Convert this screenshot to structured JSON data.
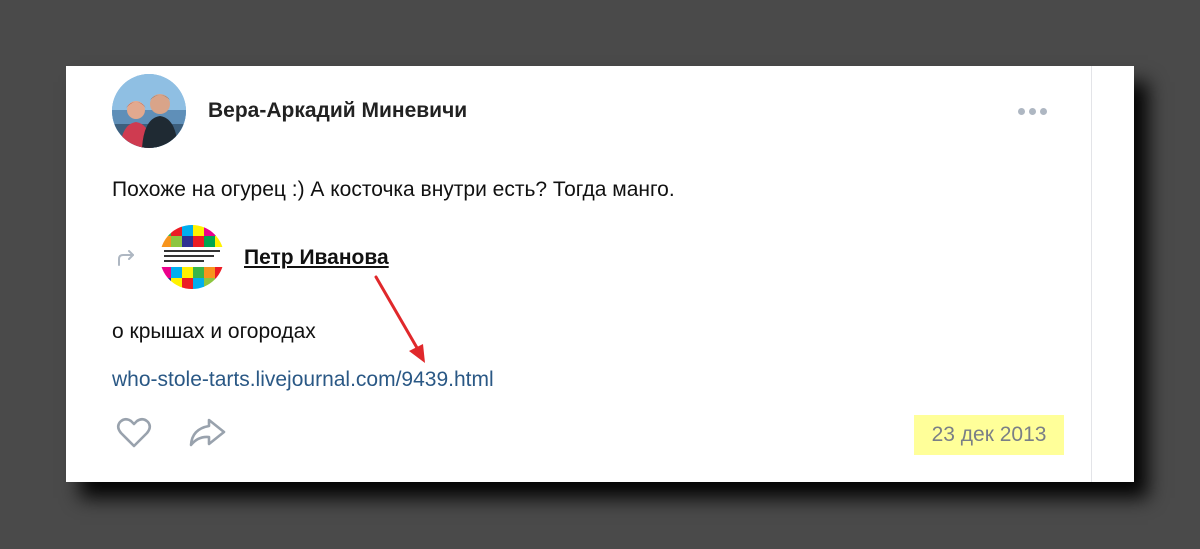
{
  "post": {
    "author_name": "Вера-Аркадий Миневичи",
    "text": "Похоже на огурец :) А косточка внутри есть? Тогда манго.",
    "date": "23 дек 2013"
  },
  "repost": {
    "author_name": "Петр Иванова",
    "text": "о крышах и огородах",
    "link": "who-stole-tarts.livejournal.com/9439.html"
  },
  "icons": {
    "more": "more-dots-icon",
    "repost": "repost-arrow-icon",
    "like": "heart-icon",
    "share": "share-arrow-icon"
  },
  "colors": {
    "background": "#4a4a4a",
    "card": "#ffffff",
    "link": "#2a5885",
    "date_highlight": "#ffff99",
    "annotation_arrow": "#e0282b",
    "icon_gray": "#99a2ad"
  }
}
